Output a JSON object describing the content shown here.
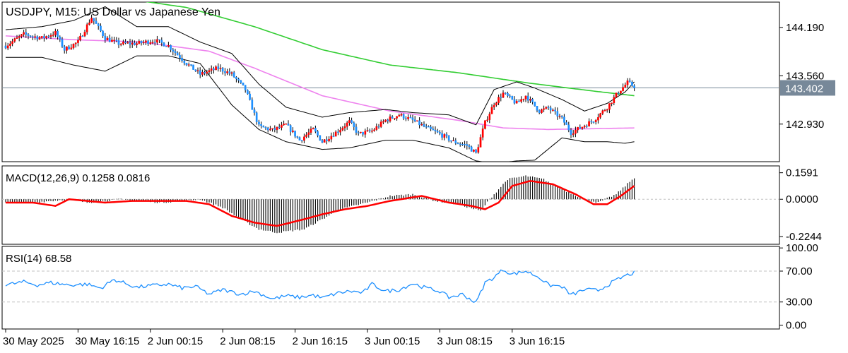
{
  "chart_data": {
    "type": "candlestick",
    "title": "USDJPY, M15:  US Dollar vs Japanese Yen",
    "current_price": "143.402",
    "price_axis": {
      "ticks": [
        "144.190",
        "143.560",
        "142.930"
      ],
      "range": [
        142.44,
        144.52
      ]
    },
    "macd_panel": {
      "label": "MACD(12,26,9) 0.1258 0.0816",
      "ticks": [
        "0.1591",
        "0.0000",
        "-0.2244"
      ],
      "range": [
        -0.27,
        0.2
      ]
    },
    "rsi_panel": {
      "label": "RSI(14) 68.58",
      "ticks": [
        "100.00",
        "70.00",
        "30.00",
        "0.00"
      ],
      "range": [
        -5,
        102
      ]
    },
    "time_labels": [
      "30 May 2025",
      "30 May 16:15",
      "2 Jun 00:15",
      "2 Jun 08:15",
      "2 Jun 16:15",
      "3 Jun 00:15",
      "3 Jun 08:15",
      "3 Jun 16:15"
    ],
    "price_anchors": [
      [
        0,
        143.95
      ],
      [
        8,
        144.1
      ],
      [
        16,
        144.05
      ],
      [
        22,
        144.12
      ],
      [
        26,
        143.9
      ],
      [
        32,
        144.0
      ],
      [
        38,
        144.32
      ],
      [
        44,
        144.05
      ],
      [
        50,
        143.98
      ],
      [
        58,
        143.98
      ],
      [
        66,
        144.02
      ],
      [
        72,
        143.95
      ],
      [
        80,
        143.72
      ],
      [
        86,
        143.58
      ],
      [
        94,
        143.66
      ],
      [
        100,
        143.58
      ],
      [
        106,
        143.38
      ],
      [
        112,
        142.9
      ],
      [
        118,
        142.85
      ],
      [
        124,
        142.92
      ],
      [
        130,
        142.72
      ],
      [
        136,
        142.86
      ],
      [
        140,
        142.7
      ],
      [
        146,
        142.82
      ],
      [
        152,
        142.96
      ],
      [
        156,
        142.8
      ],
      [
        162,
        142.84
      ],
      [
        168,
        142.98
      ],
      [
        174,
        143.05
      ],
      [
        180,
        142.98
      ],
      [
        186,
        142.88
      ],
      [
        192,
        142.8
      ],
      [
        198,
        142.7
      ],
      [
        204,
        142.65
      ],
      [
        208,
        142.55
      ],
      [
        212,
        142.95
      ],
      [
        216,
        143.2
      ],
      [
        220,
        143.33
      ],
      [
        226,
        143.2
      ],
      [
        230,
        143.3
      ],
      [
        236,
        143.1
      ],
      [
        240,
        143.14
      ],
      [
        246,
        143.0
      ],
      [
        250,
        142.82
      ],
      [
        254,
        142.88
      ],
      [
        260,
        142.98
      ],
      [
        266,
        143.15
      ],
      [
        271,
        143.35
      ],
      [
        275,
        143.47
      ],
      [
        278,
        143.42
      ]
    ],
    "ma_green": [
      [
        0,
        144.7
      ],
      [
        40,
        144.62
      ],
      [
        80,
        144.45
      ],
      [
        110,
        144.2
      ],
      [
        140,
        143.9
      ],
      [
        170,
        143.7
      ],
      [
        200,
        143.6
      ],
      [
        230,
        143.47
      ],
      [
        260,
        143.36
      ],
      [
        278,
        143.3
      ]
    ],
    "ma_violet": [
      [
        0,
        144.08
      ],
      [
        30,
        144.03
      ],
      [
        60,
        144.0
      ],
      [
        90,
        143.88
      ],
      [
        110,
        143.66
      ],
      [
        140,
        143.3
      ],
      [
        170,
        143.1
      ],
      [
        200,
        142.98
      ],
      [
        220,
        142.88
      ],
      [
        240,
        142.86
      ],
      [
        260,
        142.87
      ],
      [
        278,
        142.88
      ]
    ],
    "bollinger": {
      "upper": [
        [
          0,
          144.16
        ],
        [
          16,
          144.2
        ],
        [
          30,
          144.28
        ],
        [
          44,
          144.46
        ],
        [
          58,
          144.2
        ],
        [
          72,
          144.2
        ],
        [
          86,
          144.0
        ],
        [
          100,
          143.85
        ],
        [
          112,
          143.45
        ],
        [
          124,
          143.15
        ],
        [
          140,
          143.02
        ],
        [
          152,
          143.08
        ],
        [
          168,
          143.12
        ],
        [
          180,
          143.08
        ],
        [
          196,
          143.05
        ],
        [
          208,
          142.92
        ],
        [
          216,
          143.38
        ],
        [
          226,
          143.48
        ],
        [
          234,
          143.4
        ],
        [
          246,
          143.25
        ],
        [
          256,
          143.1
        ],
        [
          266,
          143.2
        ],
        [
          274,
          143.35
        ],
        [
          278,
          143.48
        ]
      ],
      "lower": [
        [
          0,
          143.8
        ],
        [
          16,
          143.8
        ],
        [
          30,
          143.7
        ],
        [
          44,
          143.62
        ],
        [
          58,
          143.82
        ],
        [
          72,
          143.82
        ],
        [
          86,
          143.72
        ],
        [
          100,
          143.18
        ],
        [
          112,
          142.86
        ],
        [
          124,
          142.7
        ],
        [
          140,
          142.6
        ],
        [
          152,
          142.62
        ],
        [
          168,
          142.72
        ],
        [
          180,
          142.72
        ],
        [
          196,
          142.62
        ],
        [
          208,
          142.45
        ],
        [
          216,
          142.42
        ],
        [
          226,
          142.45
        ],
        [
          234,
          142.46
        ],
        [
          246,
          142.75
        ],
        [
          256,
          142.7
        ],
        [
          266,
          142.7
        ],
        [
          274,
          142.68
        ],
        [
          278,
          142.7
        ]
      ],
      "color": "#000000"
    },
    "macd_anchors": [
      [
        0,
        -0.02
      ],
      [
        12,
        -0.02
      ],
      [
        20,
        -0.01
      ],
      [
        28,
        0.0
      ],
      [
        36,
        -0.02
      ],
      [
        44,
        -0.01
      ],
      [
        50,
        0.0
      ],
      [
        60,
        -0.01
      ],
      [
        68,
        -0.02
      ],
      [
        78,
        -0.01
      ],
      [
        86,
        0.0
      ],
      [
        96,
        -0.05
      ],
      [
        104,
        -0.12
      ],
      [
        112,
        -0.18
      ],
      [
        120,
        -0.2
      ],
      [
        132,
        -0.18
      ],
      [
        140,
        -0.12
      ],
      [
        148,
        -0.06
      ],
      [
        160,
        -0.02
      ],
      [
        170,
        0.02
      ],
      [
        180,
        0.03
      ],
      [
        190,
        -0.01
      ],
      [
        200,
        -0.03
      ],
      [
        210,
        -0.07
      ],
      [
        214,
        0.0
      ],
      [
        222,
        0.12
      ],
      [
        230,
        0.14
      ],
      [
        238,
        0.12
      ],
      [
        246,
        0.06
      ],
      [
        256,
        0.0
      ],
      [
        262,
        -0.02
      ],
      [
        270,
        0.03
      ],
      [
        278,
        0.13
      ]
    ],
    "macd_signal": [
      [
        0,
        -0.02
      ],
      [
        12,
        -0.02
      ],
      [
        22,
        -0.04
      ],
      [
        28,
        0.0
      ],
      [
        36,
        -0.01
      ],
      [
        44,
        -0.02
      ],
      [
        56,
        -0.01
      ],
      [
        68,
        -0.01
      ],
      [
        80,
        -0.01
      ],
      [
        90,
        -0.03
      ],
      [
        100,
        -0.1
      ],
      [
        110,
        -0.14
      ],
      [
        120,
        -0.16
      ],
      [
        132,
        -0.12
      ],
      [
        140,
        -0.09
      ],
      [
        150,
        -0.06
      ],
      [
        160,
        -0.04
      ],
      [
        170,
        -0.01
      ],
      [
        184,
        0.02
      ],
      [
        196,
        -0.02
      ],
      [
        206,
        -0.04
      ],
      [
        212,
        -0.06
      ],
      [
        218,
        -0.02
      ],
      [
        224,
        0.08
      ],
      [
        232,
        0.11
      ],
      [
        242,
        0.09
      ],
      [
        252,
        0.03
      ],
      [
        260,
        -0.03
      ],
      [
        266,
        -0.03
      ],
      [
        272,
        0.02
      ],
      [
        278,
        0.08
      ]
    ],
    "rsi_anchors": [
      [
        0,
        52
      ],
      [
        8,
        56
      ],
      [
        14,
        52
      ],
      [
        20,
        55
      ],
      [
        28,
        52
      ],
      [
        36,
        53
      ],
      [
        42,
        48
      ],
      [
        48,
        59
      ],
      [
        52,
        55
      ],
      [
        58,
        49
      ],
      [
        64,
        51
      ],
      [
        72,
        53
      ],
      [
        78,
        48
      ],
      [
        84,
        50
      ],
      [
        90,
        40
      ],
      [
        96,
        46
      ],
      [
        104,
        40
      ],
      [
        110,
        44
      ],
      [
        118,
        34
      ],
      [
        124,
        38
      ],
      [
        130,
        36
      ],
      [
        136,
        39
      ],
      [
        140,
        35
      ],
      [
        146,
        41
      ],
      [
        152,
        44
      ],
      [
        158,
        42
      ],
      [
        162,
        53
      ],
      [
        168,
        44
      ],
      [
        174,
        46
      ],
      [
        180,
        54
      ],
      [
        186,
        48
      ],
      [
        192,
        44
      ],
      [
        196,
        36
      ],
      [
        202,
        40
      ],
      [
        208,
        29
      ],
      [
        212,
        55
      ],
      [
        216,
        62
      ],
      [
        220,
        72
      ],
      [
        224,
        66
      ],
      [
        230,
        70
      ],
      [
        236,
        62
      ],
      [
        240,
        52
      ],
      [
        246,
        50
      ],
      [
        250,
        39
      ],
      [
        256,
        46
      ],
      [
        262,
        45
      ],
      [
        268,
        55
      ],
      [
        274,
        64
      ],
      [
        278,
        68
      ]
    ],
    "colors": {
      "bull": "#ff0000",
      "bear": "#1e90ff",
      "ma_green": "#32cd32",
      "ma_violet": "#ee82ee",
      "macd_hist": "#000000",
      "macd_signal": "#ff0000",
      "rsi": "#1e90ff",
      "price_tag_bg": "#778899",
      "grid": "#c0c0c0",
      "axis": "#000000"
    }
  }
}
